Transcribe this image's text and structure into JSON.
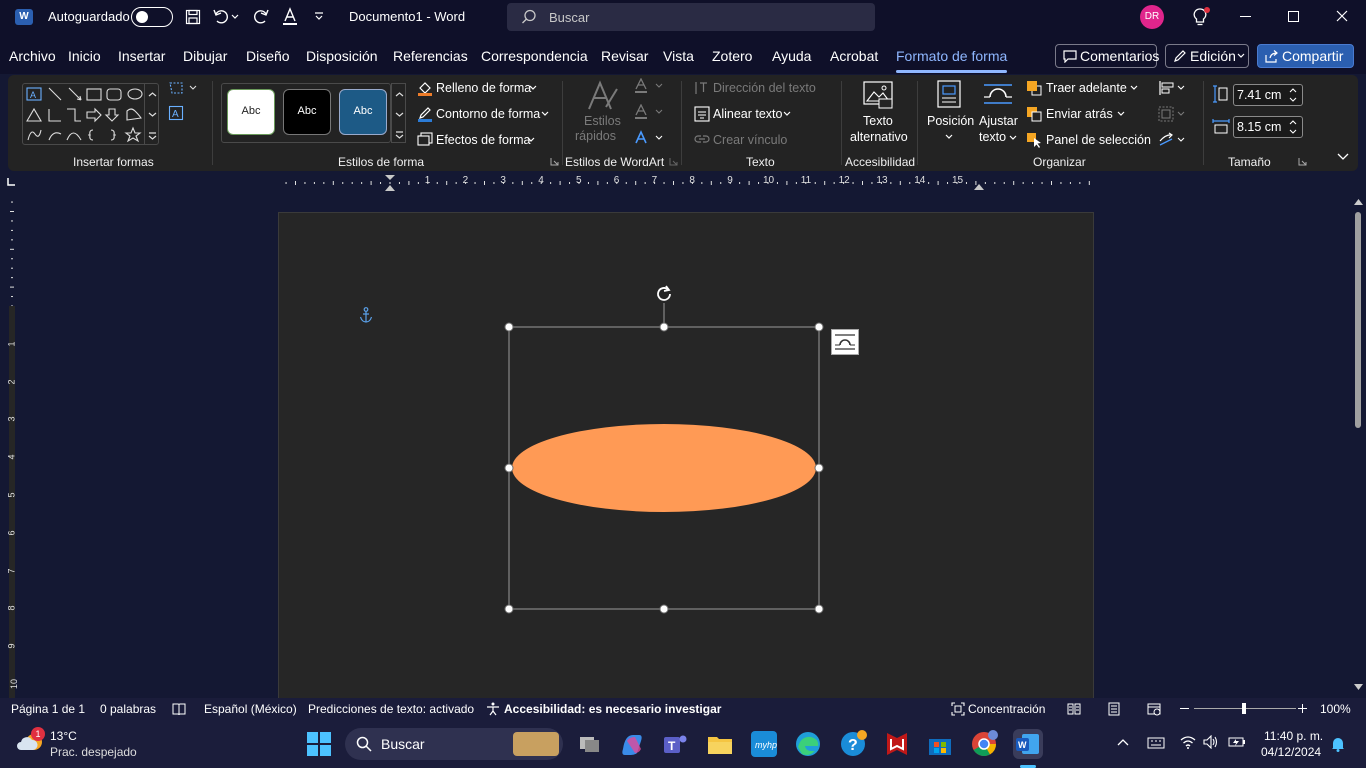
{
  "titlebar": {
    "autosave_label": "Autoguardado",
    "doc_title": "Documento1  -  Word",
    "search_placeholder": "Buscar",
    "user_initials": "DR",
    "accent_color": "#e0258c"
  },
  "menu": {
    "tabs": [
      "Archivo",
      "Inicio",
      "Insertar",
      "Dibujar",
      "Diseño",
      "Disposición",
      "Referencias",
      "Correspondencia",
      "Revisar",
      "Vista",
      "Zotero",
      "Ayuda",
      "Acrobat",
      "Formato de forma"
    ],
    "active_tab": "Formato de forma",
    "comments_label": "Comentarios",
    "edit_label": "Edición",
    "share_label": "Compartir"
  },
  "ribbon": {
    "groups": {
      "insert_shapes": "Insertar formas",
      "shape_styles": "Estilos de forma",
      "wordart_styles": "Estilos de WordArt",
      "text": "Texto",
      "accessibility": "Accesibilidad",
      "arrange": "Organizar",
      "size": "Tamaño"
    },
    "style_swatches": [
      "Abc",
      "Abc",
      "Abc"
    ],
    "shape_fill": "Relleno de forma",
    "shape_outline": "Contorno de forma",
    "shape_effects": "Efectos de forma",
    "quick_styles_1": "Estilos",
    "quick_styles_2": "rápidos",
    "text_direction": "Dirección del texto",
    "align_text": "Alinear texto",
    "create_link": "Crear vínculo",
    "alt_text_1": "Texto",
    "alt_text_2": "alternativo",
    "position": "Posición",
    "wrap_text_1": "Ajustar",
    "wrap_text_2": "texto",
    "bring_forward": "Traer adelante",
    "send_backward": "Enviar atrás",
    "selection_pane": "Panel de selección",
    "height_value": "7.41 cm",
    "width_value": "8.15 cm"
  },
  "ruler": {
    "numbers": [
      "1",
      "2",
      "3",
      "4",
      "5",
      "6",
      "7",
      "8",
      "9",
      "10",
      "11",
      "12",
      "13",
      "14",
      "15"
    ],
    "vnumbers": [
      "1",
      "2",
      "3",
      "4",
      "5",
      "6",
      "7",
      "8",
      "9",
      "10"
    ]
  },
  "shape": {
    "fill_color": "#ff9a55"
  },
  "status": {
    "page": "Página 1 de 1",
    "words": "0 palabras",
    "language": "Español (México)",
    "predictions": "Predicciones de texto: activado",
    "accessibility": "Accesibilidad: es necesario investigar",
    "focus": "Concentración",
    "zoom": "100%"
  },
  "taskbar": {
    "temperature": "13°C",
    "weather": "Prac. despejado",
    "search": "Buscar",
    "time": "11:40 p. m.",
    "date": "04/12/2024",
    "weather_badge": "1"
  }
}
